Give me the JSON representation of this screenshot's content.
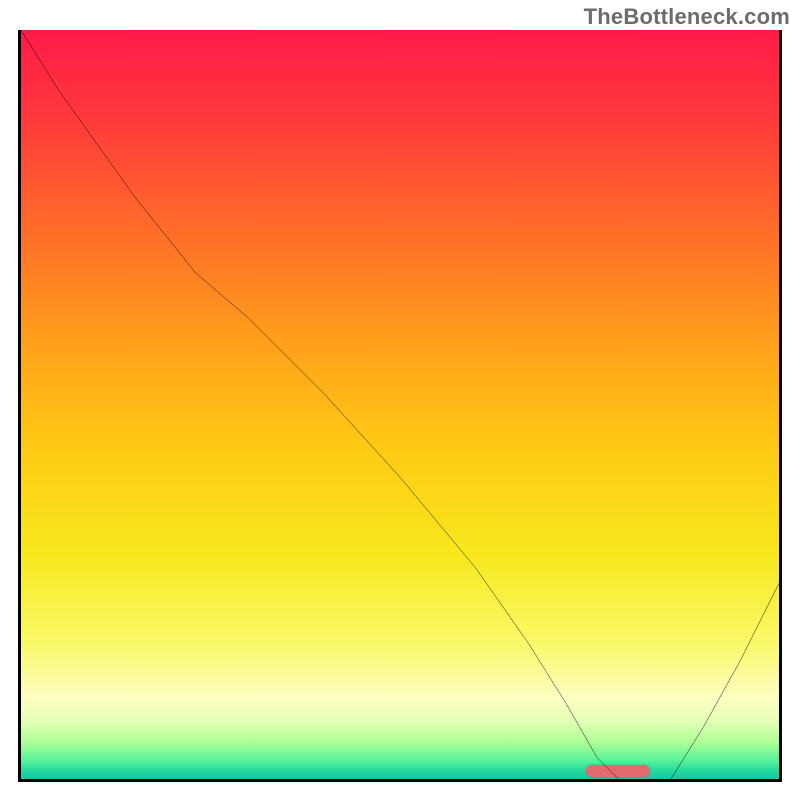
{
  "attribution": "TheBottleneck.com",
  "colors": {
    "curve": "#000000",
    "marker": "#e46a6f",
    "frame": "#000000"
  },
  "chart_data": {
    "type": "line",
    "title": "",
    "xlabel": "",
    "ylabel": "",
    "xlim": [
      0,
      100
    ],
    "ylim": [
      0,
      100
    ],
    "x": [
      0,
      5,
      15,
      23,
      30,
      40,
      50,
      60,
      67,
      72,
      76,
      80,
      85,
      90,
      95,
      100
    ],
    "values": [
      100,
      92,
      78,
      68,
      62,
      52,
      41,
      29,
      19,
      11,
      4,
      0,
      0,
      8,
      17,
      27
    ],
    "annotations": [
      {
        "kind": "min-marker",
        "x_start": 76,
        "x_end": 84,
        "y": 0
      }
    ],
    "legend": false,
    "grid": false
  },
  "marker": {
    "left_pct": 74.5,
    "width_pct": 8.5
  }
}
